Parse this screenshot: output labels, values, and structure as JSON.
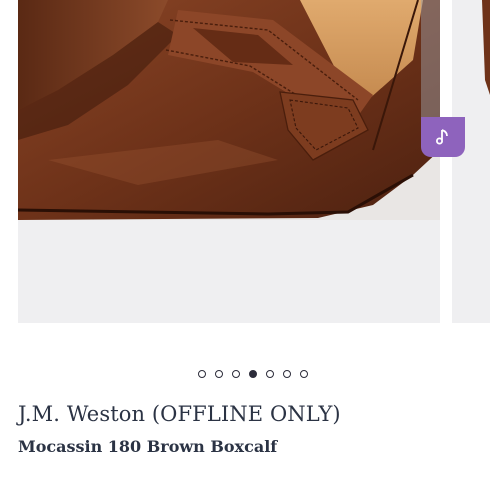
{
  "product": {
    "brand": "J.M. Weston (OFFLINE ONLY)",
    "name": "Mocassin 180 Brown Boxcalf"
  },
  "carousel": {
    "slide_count": 7,
    "active_index": 3,
    "audio_icon": "music-note-icon",
    "accent_color": "#8e63bd"
  },
  "colors": {
    "leather": "#7a3a1f",
    "background": "#efeff1",
    "text": "#2b3344"
  }
}
